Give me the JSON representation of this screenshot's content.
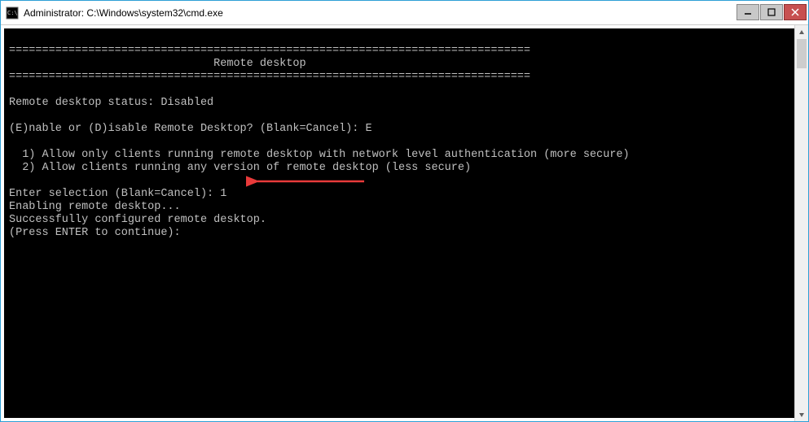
{
  "window": {
    "title": "Administrator: C:\\Windows\\system32\\cmd.exe"
  },
  "console": {
    "separator": "===============================================================================",
    "heading_spaces": "                               ",
    "heading": "Remote desktop",
    "status_line": "Remote desktop status: Disabled",
    "prompt_enable": "(E)nable or (D)isable Remote Desktop? (Blank=Cancel): E",
    "option1": "  1) Allow only clients running remote desktop with network level authentication (more secure)",
    "option2": "  2) Allow clients running any version of remote desktop (less secure)",
    "prompt_selection": "Enter selection (Blank=Cancel): 1",
    "enabling": "Enabling remote desktop...",
    "success": "Successfully configured remote desktop.",
    "press_enter": "(Press ENTER to continue):"
  }
}
